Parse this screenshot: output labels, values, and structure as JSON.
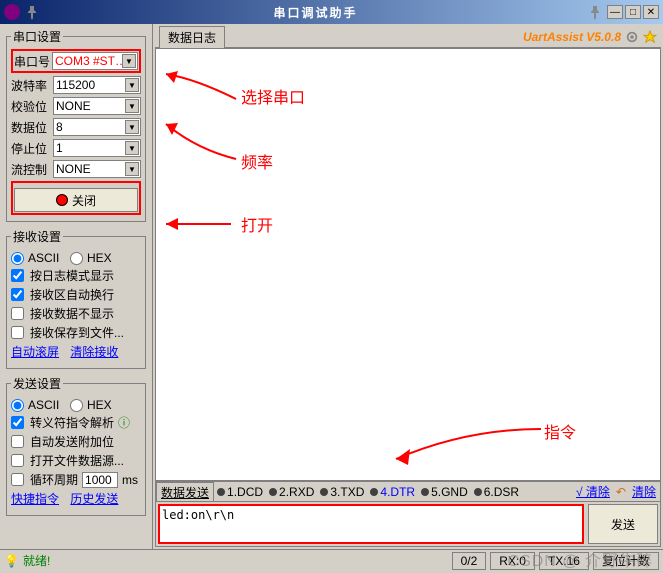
{
  "window": {
    "title": "串口调试助手",
    "brand": "UartAssist V5.0.8"
  },
  "port_settings": {
    "legend": "串口设置",
    "port_label": "串口号",
    "port_value": "COM3 #ST…",
    "baud_label": "波特率",
    "baud_value": "115200",
    "parity_label": "校验位",
    "parity_value": "NONE",
    "data_label": "数据位",
    "data_value": "8",
    "stop_label": "停止位",
    "stop_value": "1",
    "flow_label": "流控制",
    "flow_value": "NONE",
    "close_btn": "关闭"
  },
  "recv_settings": {
    "legend": "接收设置",
    "ascii": "ASCII",
    "hex": "HEX",
    "log_mode": "按日志模式显示",
    "auto_wrap": "接收区自动换行",
    "hide_data": "接收数据不显示",
    "save_file": "接收保存到文件...",
    "auto_scroll": "自动滚屏",
    "clear_recv": "清除接收"
  },
  "send_settings": {
    "legend": "发送设置",
    "ascii": "ASCII",
    "hex": "HEX",
    "escape": "转义符指令解析",
    "auto_append": "自动发送附加位",
    "open_file": "打开文件数据源...",
    "cycle_label": "循环周期",
    "cycle_value": "1000",
    "cycle_unit": "ms",
    "quick_cmd": "快捷指令",
    "history": "历史发送"
  },
  "log": {
    "tab": "数据日志"
  },
  "send_area": {
    "tab": "数据发送",
    "sig1": "1.DCD",
    "sig2": "2.RXD",
    "sig3": "3.TXD",
    "sig4": "4.DTR",
    "sig5": "5.GND",
    "sig6": "6.DSR",
    "clear_top": "√ 清除",
    "clear_r": "清除",
    "input_value": "led:on\\r\\n",
    "send_btn": "发送"
  },
  "status": {
    "ready": "就绪!",
    "counter": "0/2",
    "rx": "RX:0",
    "tx": "TX:16",
    "reset": "复位计数"
  },
  "annotations": {
    "select_port": "选择串口",
    "frequency": "频率",
    "open": "打开",
    "command": "指令"
  },
  "watermark": "CSDN @ 介野牛碎"
}
